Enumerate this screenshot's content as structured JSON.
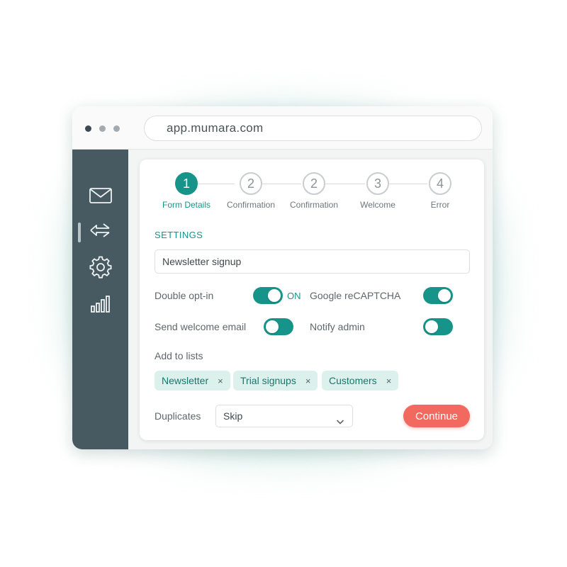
{
  "browser": {
    "url": "app.mumara.com"
  },
  "sidebar": {
    "icons": [
      "mail-icon",
      "switch-arrows-icon",
      "gear-icon",
      "bar-chart-icon"
    ],
    "active_index": 1
  },
  "steps": [
    {
      "number": "1",
      "label": "Form Details",
      "active": true
    },
    {
      "number": "2",
      "label": "Confirmation",
      "active": false
    },
    {
      "number": "2",
      "label": "Confirmation",
      "active": false
    },
    {
      "number": "3",
      "label": "Welcome",
      "active": false
    },
    {
      "number": "4",
      "label": "Error",
      "active": false
    }
  ],
  "settings": {
    "title": "SETTINGS",
    "form_name": "Newsletter signup",
    "double_optin": {
      "label": "Double opt-in",
      "state_text": "ON",
      "enabled": true
    },
    "recaptcha": {
      "label": "Google reCAPTCHA",
      "enabled": true
    },
    "welcome_email": {
      "label": "Send welcome email",
      "enabled": true
    },
    "notify_admin": {
      "label": "Notify admin",
      "enabled": true
    }
  },
  "lists": {
    "label": "Add to lists",
    "items": [
      "Newsletter",
      "Trial signups",
      "Customers"
    ],
    "remove_glyph": "×"
  },
  "duplicates": {
    "label": "Duplicates",
    "selected": "Skip"
  },
  "actions": {
    "continue_label": "Continue"
  },
  "colors": {
    "accent": "#17948a",
    "sidebar": "#475a62",
    "button": "#f26a5f",
    "chip": "#dcf0ec"
  }
}
